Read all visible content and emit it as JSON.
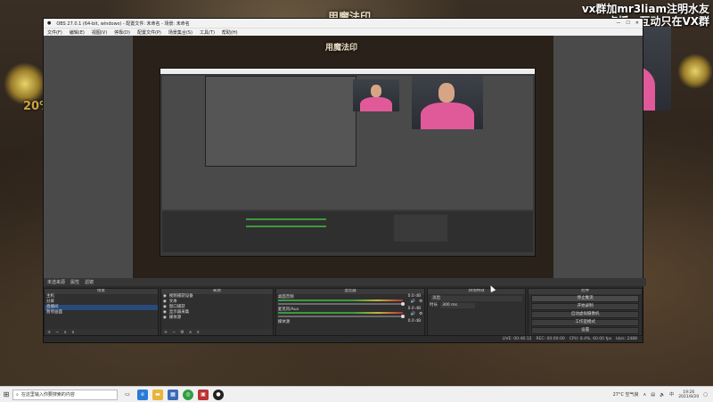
{
  "background": {
    "game_title": "用魔法印",
    "inner_game_title": "用魔法印",
    "left_badge": "20%",
    "colors": {
      "accent": "#c9a441",
      "bg": "#2b2219"
    }
  },
  "stream_overlay": {
    "line1": "vx群加mr3liam注明水友",
    "line2": "点播，互动只在VX群"
  },
  "obs": {
    "title": "OBS 27.0.1 (64-bit, windows) - 配置文件: 未命名 - 场景: 未命名",
    "menu": [
      "文件(F)",
      "编辑(E)",
      "视图(V)",
      "停靠(D)",
      "配置文件(P)",
      "场景集合(S)",
      "工具(T)",
      "帮助(H)"
    ],
    "scene_bar_label": "未选来源",
    "scene_bar_buttons": [
      "属性",
      "滤镜"
    ],
    "docks": {
      "scenes": {
        "title": "场景",
        "items": [
          "主机",
          "分屏",
          "直播间",
          "暂停画面"
        ],
        "selected": 2
      },
      "sources": {
        "title": "来源",
        "items": [
          "视频捕获设备",
          "文本",
          "窗口捕获",
          "显示器采集",
          "媒体源"
        ]
      },
      "mixer": {
        "title": "混音器",
        "channels": [
          {
            "name": "桌面音频",
            "db": "0.0 dB"
          },
          {
            "name": "麦克风/Aux",
            "db": "0.0 dB"
          },
          {
            "name": "媒体源",
            "db": "0.0 dB"
          }
        ]
      },
      "transitions": {
        "title": "转场特效",
        "type": "淡出",
        "duration_label": "时长",
        "duration": "300 ms"
      },
      "controls": {
        "title": "控件",
        "buttons": [
          "停止推流",
          "开始录制",
          "启动虚拟摄像机",
          "工作室模式",
          "设置",
          "退出"
        ]
      }
    },
    "status": {
      "live": "LIVE: 00:46:12",
      "rec": "REC: 00:00:00",
      "cpu": "CPU: 8.4%, 60.00 fps",
      "kbps": "kb/s: 2488"
    }
  },
  "taskbar": {
    "search_placeholder": "在这里输入你要搜索的内容",
    "weather": "27°C 空气良",
    "time": "19:26",
    "date": "2021/8/20"
  }
}
